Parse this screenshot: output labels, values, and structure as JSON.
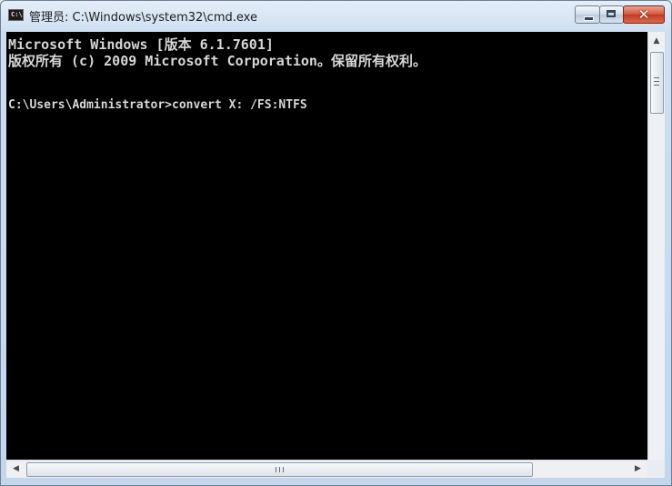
{
  "window": {
    "title": "管理员: C:\\Windows\\system32\\cmd.exe",
    "icon": "cmd-icon",
    "icon_text": "C:\\"
  },
  "controls": {
    "minimize": "minimize-icon",
    "maximize": "maximize-icon",
    "close": "close-icon",
    "close_glyph": "✕",
    "close_color": "#c9442b"
  },
  "console": {
    "background": "#000000",
    "foreground": "#d6d6d6",
    "lines": [
      "Microsoft Windows [版本 6.1.7601]",
      "版权所有 (c) 2009 Microsoft Corporation。保留所有权利。",
      "",
      "C:\\Users\\Administrator>convert X: /FS:NTFS"
    ]
  },
  "scrollbars": {
    "up_arrow": "▲",
    "left_arrow": "◀",
    "right_arrow": "▶"
  }
}
